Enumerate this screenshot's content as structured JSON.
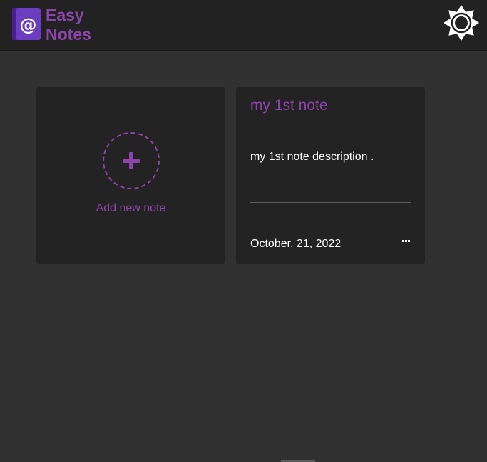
{
  "app": {
    "name_line1": "Easy",
    "name_line2": "Notes",
    "logo_glyph": "@",
    "logo_icon": "notebook-at-icon",
    "theme_icon": "sun-icon"
  },
  "colors": {
    "accent": "#8e44ad",
    "header_bg": "#222222",
    "page_bg": "#313131",
    "card_bg": "#232323",
    "text": "#ffffff"
  },
  "add_card": {
    "icon": "plus-icon",
    "label": "Add new note"
  },
  "notes": [
    {
      "title": "my 1st note",
      "description": "my 1st note description .",
      "date": "October, 21, 2022",
      "menu_icon": "more-icon"
    }
  ]
}
